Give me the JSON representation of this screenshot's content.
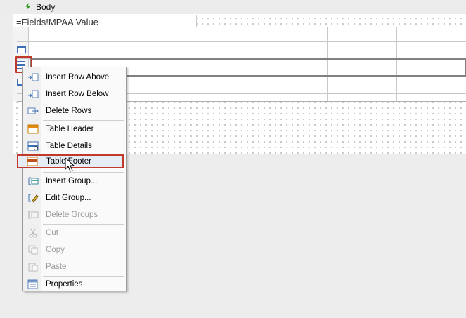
{
  "band": {
    "label": "Body",
    "icon": "lightning-icon"
  },
  "textbox": {
    "expression": "=Fields!MPAA Value"
  },
  "menu": {
    "items": [
      {
        "label": "Insert Row Above",
        "icon": "insert-row-above-icon",
        "enabled": true
      },
      {
        "label": "Insert Row Below",
        "icon": "insert-row-below-icon",
        "enabled": true
      },
      {
        "label": "Delete Rows",
        "icon": "delete-rows-icon",
        "enabled": true
      },
      {
        "label": "Table Header",
        "icon": "table-header-icon",
        "enabled": true
      },
      {
        "label": "Table Details",
        "icon": "table-details-icon",
        "enabled": true
      },
      {
        "label": "Table Footer",
        "icon": "table-footer-icon",
        "enabled": true,
        "highlighted": true
      },
      {
        "label": "Insert Group...",
        "icon": "insert-group-icon",
        "enabled": true
      },
      {
        "label": "Edit Group...",
        "icon": "edit-group-icon",
        "enabled": true
      },
      {
        "label": "Delete Groups",
        "icon": "delete-groups-icon",
        "enabled": false
      },
      {
        "label": "Cut",
        "icon": "scissors-icon",
        "enabled": false
      },
      {
        "label": "Copy",
        "icon": "copy-icon",
        "enabled": false
      },
      {
        "label": "Paste",
        "icon": "paste-icon",
        "enabled": false
      },
      {
        "label": "Properties",
        "icon": "properties-icon",
        "enabled": true
      }
    ]
  },
  "colors": {
    "highlight_border": "#c0392b",
    "menu_hover": "#e6ecf5"
  }
}
